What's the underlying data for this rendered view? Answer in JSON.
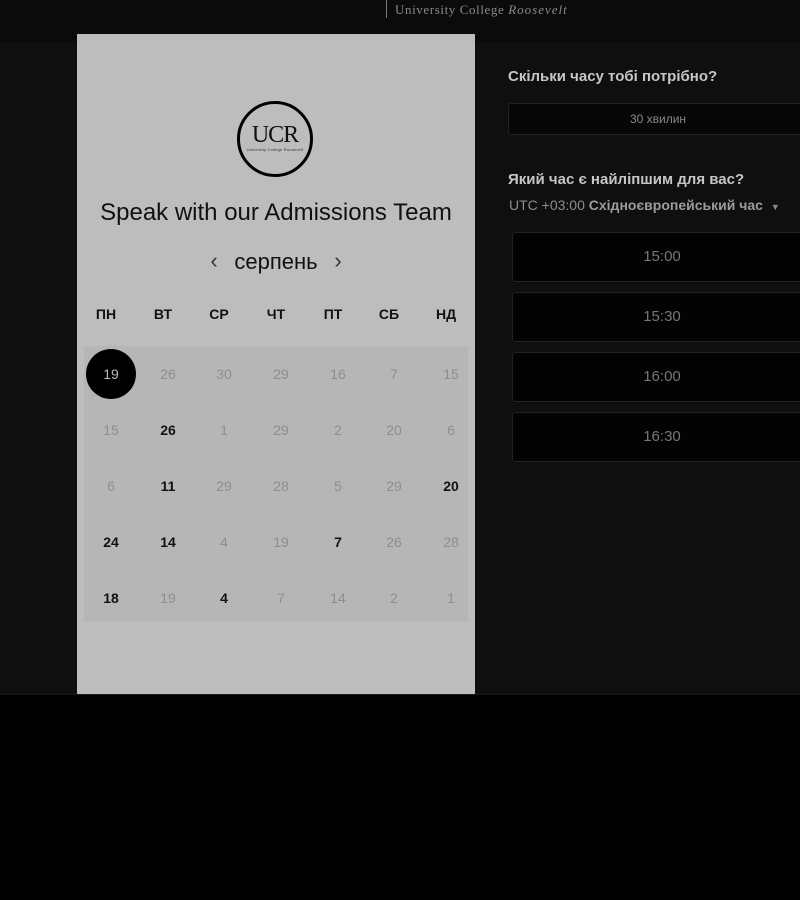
{
  "header": {
    "brand_regular": "University College",
    "brand_italic": "Roosevelt"
  },
  "card": {
    "logo_text": "UCR",
    "logo_subtext": "University College Roosevelt",
    "title": "Speak with our Admissions Team",
    "month": "серпень",
    "prev_icon": "chevron-left-icon",
    "next_icon": "chevron-right-icon",
    "weekdays": [
      "ПН",
      "ВТ",
      "СР",
      "ЧТ",
      "ПТ",
      "СБ",
      "НД"
    ],
    "weeks": [
      [
        {
          "d": "19",
          "selected": true
        },
        {
          "d": "26"
        },
        {
          "d": "30"
        },
        {
          "d": "29"
        },
        {
          "d": "16"
        },
        {
          "d": "7"
        },
        {
          "d": "15"
        }
      ],
      [
        {
          "d": "15"
        },
        {
          "d": "26",
          "available": true
        },
        {
          "d": "1"
        },
        {
          "d": "29"
        },
        {
          "d": "2"
        },
        {
          "d": "20"
        },
        {
          "d": "6"
        }
      ],
      [
        {
          "d": "6"
        },
        {
          "d": "11",
          "available": true
        },
        {
          "d": "29"
        },
        {
          "d": "28"
        },
        {
          "d": "5"
        },
        {
          "d": "29"
        },
        {
          "d": "20",
          "available": true
        }
      ],
      [
        {
          "d": "24",
          "available": true
        },
        {
          "d": "14",
          "available": true
        },
        {
          "d": "4"
        },
        {
          "d": "19"
        },
        {
          "d": "7",
          "available": true
        },
        {
          "d": "26"
        },
        {
          "d": "28"
        }
      ],
      [
        {
          "d": "18",
          "available": true
        },
        {
          "d": "19"
        },
        {
          "d": "4",
          "available": true
        },
        {
          "d": "7"
        },
        {
          "d": "14"
        },
        {
          "d": "2"
        },
        {
          "d": "1"
        }
      ]
    ]
  },
  "panel": {
    "duration_question": "Скільки часу тобі потрібно?",
    "duration_value": "30 хвилин",
    "time_question": "Який час є найліпшим для вас?",
    "timezone_offset": "UTC +03:00",
    "timezone_name": "Східноєвропейський час",
    "timezone_caret_icon": "caret-down-icon",
    "slots": [
      "15:00",
      "15:30",
      "16:00",
      "16:30"
    ]
  },
  "colors": {
    "page_bg": "#000000",
    "card_bg": "#bdbdbd",
    "selected_day": "#000000"
  }
}
